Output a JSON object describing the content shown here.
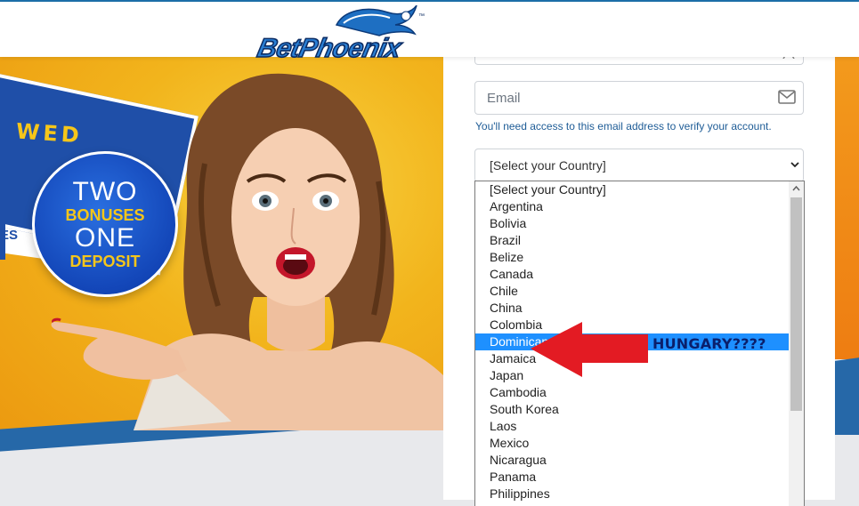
{
  "header": {
    "logo_text": "BetPhoenix",
    "logo_icon": "phoenix-icon"
  },
  "hero": {
    "banner_word": "WED",
    "banner_fragment": "ES",
    "badge": {
      "line1": "TWO",
      "line2": "BONUSES",
      "line3": "ONE",
      "line4": "DEPOSIT"
    }
  },
  "form": {
    "email": {
      "placeholder": "Email",
      "value": "",
      "icon": "mail-icon"
    },
    "email_help": "You'll need access to this email address to verify your account.",
    "country": {
      "selected": "[Select your Country]",
      "options": [
        "[Select your Country]",
        "Argentina",
        "Bolivia",
        "Brazil",
        "Belize",
        "Canada",
        "Chile",
        "China",
        "Colombia",
        "Dominican Republic",
        "Jamaica",
        "Japan",
        "Cambodia",
        "South Korea",
        "Laos",
        "Mexico",
        "Nicaragua",
        "Panama",
        "Philippines"
      ],
      "highlighted_option": "Dominican Republic"
    }
  },
  "annotation": {
    "text": "HUNGARY????",
    "arrow_color": "#e31b23"
  },
  "colors": {
    "brand_blue": "#1f4fa8",
    "accent_yellow": "#f5c61a",
    "highlight": "#1e90ff",
    "link_blue": "#1e5c96"
  }
}
